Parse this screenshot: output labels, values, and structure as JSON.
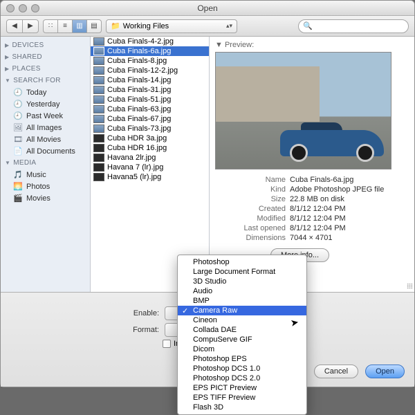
{
  "window": {
    "title": "Open"
  },
  "toolbar": {
    "path_label": "Working Files",
    "search_placeholder": ""
  },
  "sidebar": {
    "sections": [
      {
        "label": "DEVICES",
        "expanded": false,
        "items": []
      },
      {
        "label": "SHARED",
        "expanded": false,
        "items": []
      },
      {
        "label": "PLACES",
        "expanded": false,
        "items": []
      },
      {
        "label": "SEARCH FOR",
        "expanded": true,
        "items": [
          {
            "label": "Today",
            "icon": "clock"
          },
          {
            "label": "Yesterday",
            "icon": "clock"
          },
          {
            "label": "Past Week",
            "icon": "clock"
          },
          {
            "label": "All Images",
            "icon": "images"
          },
          {
            "label": "All Movies",
            "icon": "movies"
          },
          {
            "label": "All Documents",
            "icon": "documents"
          }
        ]
      },
      {
        "label": "MEDIA",
        "expanded": true,
        "items": [
          {
            "label": "Music",
            "icon": "music"
          },
          {
            "label": "Photos",
            "icon": "photos",
            "yellow": true
          },
          {
            "label": "Movies",
            "icon": "film",
            "yellow": true
          }
        ]
      }
    ]
  },
  "files": [
    {
      "name": "Cuba Finals-4-2.jpg",
      "kind": "jpeg"
    },
    {
      "name": "Cuba Finals-6a.jpg",
      "kind": "jpeg",
      "selected": true
    },
    {
      "name": "Cuba Finals-8.jpg",
      "kind": "jpeg"
    },
    {
      "name": "Cuba Finals-12-2.jpg",
      "kind": "jpeg"
    },
    {
      "name": "Cuba Finals-14.jpg",
      "kind": "jpeg"
    },
    {
      "name": "Cuba Finals-31.jpg",
      "kind": "jpeg"
    },
    {
      "name": "Cuba Finals-51.jpg",
      "kind": "jpeg"
    },
    {
      "name": "Cuba Finals-63.jpg",
      "kind": "jpeg"
    },
    {
      "name": "Cuba Finals-67.jpg",
      "kind": "jpeg"
    },
    {
      "name": "Cuba Finals-73.jpg",
      "kind": "jpeg"
    },
    {
      "name": "Cuba HDR 3a.jpg",
      "kind": "hdr"
    },
    {
      "name": "Cuba HDR 16.jpg",
      "kind": "hdr"
    },
    {
      "name": "Havana 2lr.jpg",
      "kind": "hdr"
    },
    {
      "name": "Havana 7 (lr).jpg",
      "kind": "hdr"
    },
    {
      "name": "Havana5 (lr).jpg",
      "kind": "hdr"
    }
  ],
  "preview": {
    "header": "Preview:",
    "meta": [
      {
        "k": "Name",
        "v": "Cuba Finals-6a.jpg"
      },
      {
        "k": "Kind",
        "v": "Adobe Photoshop JPEG file"
      },
      {
        "k": "Size",
        "v": "22.8 MB on disk"
      },
      {
        "k": "Created",
        "v": "8/1/12 12:04 PM"
      },
      {
        "k": "Modified",
        "v": "8/1/12 12:04 PM"
      },
      {
        "k": "Last opened",
        "v": "8/1/12 12:04 PM"
      },
      {
        "k": "Dimensions",
        "v": "7044 × 4701"
      }
    ],
    "more_info": "More info..."
  },
  "bottom": {
    "enable_label": "Enable:",
    "format_label": "Format:",
    "image_sequence_label": "Image Sequence",
    "cancel": "Cancel",
    "open": "Open"
  },
  "format_menu": {
    "items": [
      "Photoshop",
      "Large Document Format",
      "3D Studio",
      "Audio",
      "BMP",
      "Camera Raw",
      "Cineon",
      "Collada DAE",
      "CompuServe GIF",
      "Dicom",
      "Photoshop EPS",
      "Photoshop DCS 1.0",
      "Photoshop DCS 2.0",
      "EPS PICT Preview",
      "EPS TIFF Preview",
      "Flash 3D"
    ],
    "selected_index": 5
  }
}
